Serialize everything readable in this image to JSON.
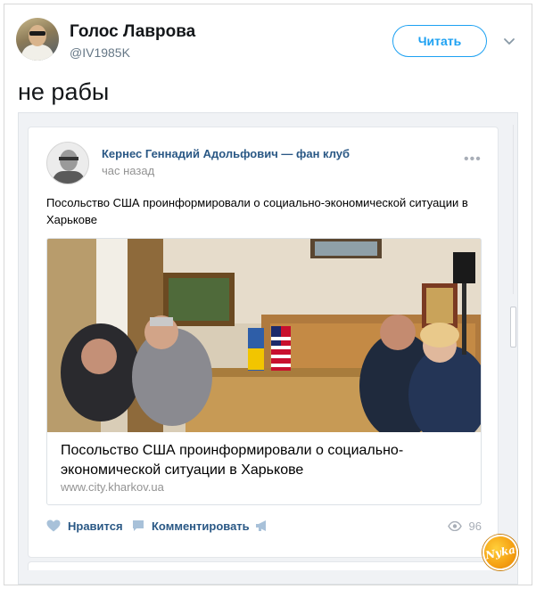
{
  "tweet": {
    "author_name": "Голос Лаврова",
    "author_handle": "@IV1985K",
    "follow_label": "Читать",
    "text": "не рабы"
  },
  "vk_post": {
    "group_name": "Кернес Геннадий Адольфович — фан клуб",
    "time": "час назад",
    "more_label": "•••",
    "text": "Посольство США проинформировали о социально-экономической ситуации в Харькове",
    "link": {
      "title": "Посольство США проинформировали о социально-экономической ситуации в Харькове",
      "domain": "www.city.kharkov.ua"
    },
    "actions": {
      "like_label": "Нравится",
      "comment_label": "Комментировать",
      "views_count": "96"
    }
  },
  "icons": {
    "like": "heart-icon",
    "comment": "comment-icon",
    "share": "megaphone-icon",
    "views": "eye-icon",
    "menu": "chevron-down-icon"
  },
  "colors": {
    "twitter_blue": "#1da1f2",
    "vk_link": "#2a5885",
    "muted": "#939393"
  },
  "watermark_text": "Nyka"
}
